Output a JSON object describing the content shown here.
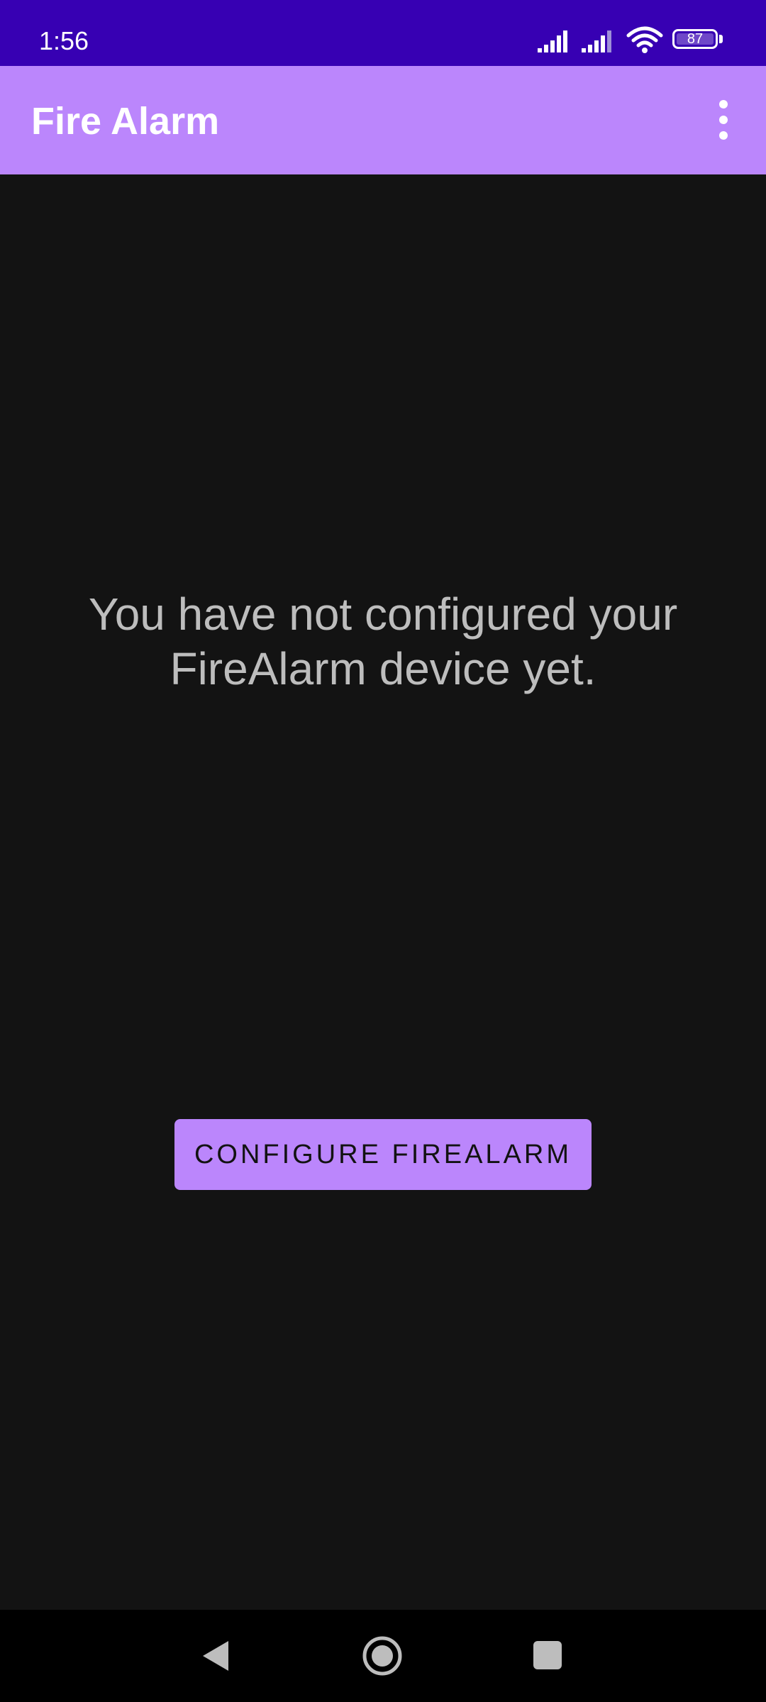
{
  "status_bar": {
    "time": "1:56",
    "battery_level": "87",
    "icons": [
      "signal-icon",
      "signal-icon",
      "wifi-icon",
      "battery-icon"
    ]
  },
  "app_bar": {
    "title": "Fire Alarm",
    "menu_icon": "more-vert-icon"
  },
  "main": {
    "message": "You have not configured your FireAlarm device yet.",
    "configure_button_label": "CONFIGURE FIREALARM"
  },
  "nav_bar": {
    "icons": [
      "back-icon",
      "home-icon",
      "recents-icon"
    ]
  },
  "colors": {
    "status_bar": "#3700b3",
    "app_bar": "#bb86fc",
    "background": "#131313",
    "button": "#bb86fc",
    "message_text": "#bdbdbd"
  }
}
